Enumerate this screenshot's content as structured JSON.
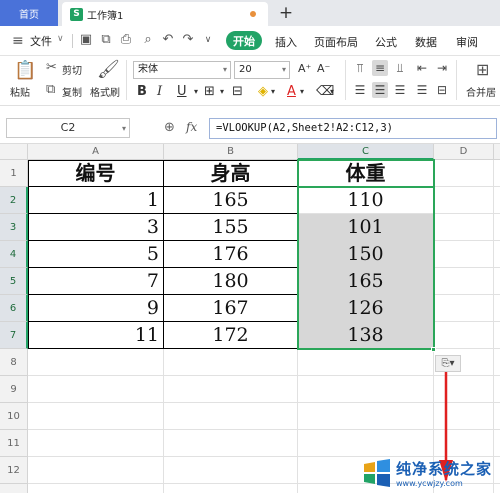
{
  "tabs": {
    "home": "首页",
    "doc_icon": "S",
    "doc_title": "工作簿1",
    "new_tab": "+"
  },
  "menubar": {
    "file": "文件",
    "start": "开始",
    "items": [
      "插入",
      "页面布局",
      "公式",
      "数据",
      "审阅"
    ]
  },
  "ribbon": {
    "paste": "粘贴",
    "cut": "剪切",
    "copy": "复制",
    "format_painter": "格式刷",
    "font_name": "宋体",
    "font_size": "20",
    "merge_center": "合并居"
  },
  "formula_bar": {
    "name_box": "C2",
    "fx": "fx",
    "formula": "=VLOOKUP(A2,Sheet2!A2:C12,3)"
  },
  "sheet": {
    "columns": [
      "A",
      "B",
      "C",
      "D"
    ],
    "rows": [
      "1",
      "2",
      "3",
      "4",
      "5",
      "6",
      "7",
      "8",
      "9",
      "10",
      "11",
      "12"
    ],
    "header": [
      "编号",
      "身高",
      "体重"
    ],
    "data": [
      [
        "1",
        "165",
        "110"
      ],
      [
        "3",
        "155",
        "101"
      ],
      [
        "5",
        "176",
        "150"
      ],
      [
        "7",
        "180",
        "165"
      ],
      [
        "9",
        "167",
        "126"
      ],
      [
        "11",
        "172",
        "138"
      ]
    ]
  },
  "watermark": {
    "title": "纯净系统之家",
    "url": "www.ycwjzy.com"
  },
  "colors": {
    "accent_green": "#21a366",
    "home_tab_blue": "#4a72d9",
    "annotation_red": "#e02020"
  }
}
